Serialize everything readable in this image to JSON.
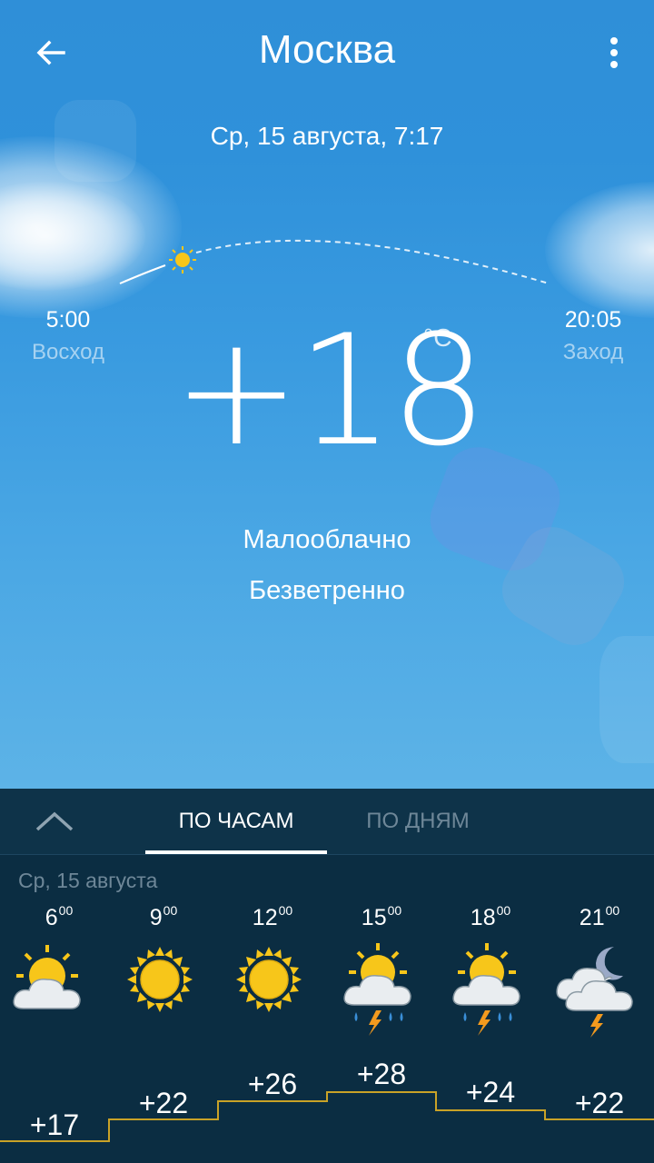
{
  "header": {
    "city": "Москва",
    "datetime": "Ср, 15 августа, 7:17"
  },
  "sun": {
    "sunrise_time": "5:00",
    "sunrise_label": "Восход",
    "sunset_time": "20:05",
    "sunset_label": "Заход"
  },
  "current": {
    "temperature": "+18",
    "unit": "°C",
    "condition": "Малооблачно",
    "wind": "Безветренно"
  },
  "tabs": {
    "hourly": "ПО ЧАСАМ",
    "daily": "ПО ДНЯМ"
  },
  "forecast": {
    "day": "Ср, 15 августа",
    "hours": [
      {
        "hour": "6",
        "minutes": "00",
        "temp": "+17",
        "icon": "partly-cloudy-icon"
      },
      {
        "hour": "9",
        "minutes": "00",
        "temp": "+22",
        "icon": "sun-icon"
      },
      {
        "hour": "12",
        "minutes": "00",
        "temp": "+26",
        "icon": "sun-icon"
      },
      {
        "hour": "15",
        "minutes": "00",
        "temp": "+28",
        "icon": "thunderstorm-rain-icon"
      },
      {
        "hour": "18",
        "minutes": "00",
        "temp": "+24",
        "icon": "thunderstorm-rain-icon"
      },
      {
        "hour": "21",
        "minutes": "00",
        "temp": "+22",
        "icon": "night-cloudy-thunder-icon"
      }
    ]
  },
  "colors": {
    "sky_top": "#2f8fd8",
    "panel": "#0b2d42",
    "sun": "#f7c61a",
    "graph_line": "#c9a227",
    "tab_inactive": "#6e8798"
  }
}
